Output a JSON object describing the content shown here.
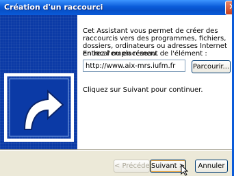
{
  "window": {
    "title": "Création d'un raccourci",
    "close_glyph": "✕"
  },
  "content": {
    "description": "Cet Assistant vous permet de créer des raccourcis vers des programmes, fichiers, dossiers, ordinateurs ou adresses Internet en local ou en réseau.",
    "location_label": "Entrez l'emplacement de l'élément :",
    "location_value": "http://www.aix-mrs.iufm.fr",
    "browse_label": "Parcourir...",
    "hint": "Cliquez sur Suivant pour continuer."
  },
  "footer": {
    "back_label": "< Précédent",
    "next_label": "Suivant >",
    "cancel_label": "Annuler"
  },
  "colors": {
    "title_bar": "#0a5bd9",
    "side_panel": "#0b3aa6",
    "dialog_bg": "#ece9d8",
    "close_button": "#c6401f"
  },
  "icons": {
    "side_graphic": "shortcut-arrow-icon",
    "pointer": "mouse-cursor-icon"
  }
}
